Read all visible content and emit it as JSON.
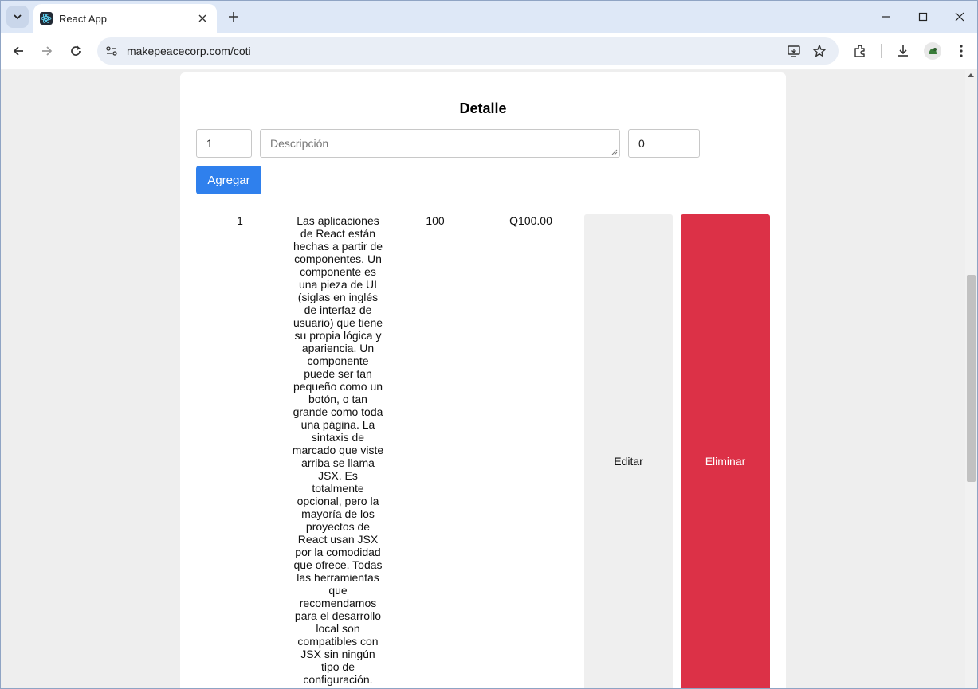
{
  "browser": {
    "tab_title": "React App",
    "url": "makepeacecorp.com/coti"
  },
  "page": {
    "section_title": "Detalle",
    "form": {
      "quantity_value": "1",
      "description_placeholder": "Descripción",
      "price_value": "0",
      "add_button_label": "Agregar"
    },
    "items": [
      {
        "quantity": "1",
        "description": "Las aplicaciones de React están hechas a partir de componentes. Un componente es una pieza de UI (siglas en inglés de interfaz de usuario) que tiene su propia lógica y apariencia. Un componente puede ser tan pequeño como un botón, o tan grande como toda una página. La sintaxis de marcado que viste arriba se llama JSX. Es totalmente opcional, pero la mayoría de los proyectos de React usan JSX por la comodidad que ofrece. Todas las herramientas que recomendamos para el desarrollo local son compatibles con JSX sin ningún tipo de configuración.",
        "price": "100",
        "total": "Q100.00",
        "edit_label": "Editar",
        "delete_label": "Eliminar"
      }
    ]
  },
  "colors": {
    "primary": "#2f80ed",
    "danger": "#dc3147",
    "neutral_button": "#efefef"
  },
  "icons": [
    "tab-search-icon",
    "react-icon",
    "close-icon",
    "new-tab-icon",
    "minimize-icon",
    "maximize-icon",
    "window-close-icon",
    "back-icon",
    "forward-icon",
    "reload-icon",
    "site-info-icon",
    "install-app-icon",
    "bookmark-star-icon",
    "extensions-icon",
    "download-icon",
    "profile-avatar",
    "menu-icon"
  ]
}
